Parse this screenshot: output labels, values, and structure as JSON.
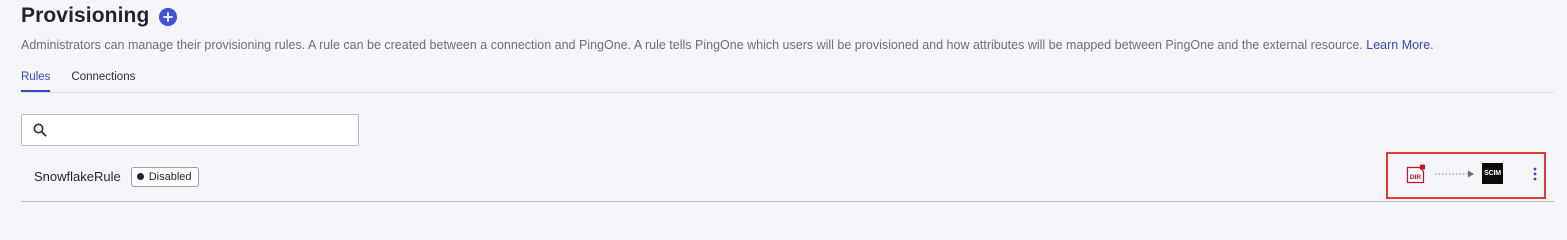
{
  "header": {
    "title": "Provisioning",
    "add_icon": "plus-circle-icon",
    "description": "Administrators can manage their provisioning rules. A rule can be created between a connection and PingOne. A rule tells PingOne which users will be provisioned and how attributes will be mapped between PingOne and the external resource.",
    "learn_more_label": "Learn More."
  },
  "tabs": [
    {
      "label": "Rules",
      "active": true
    },
    {
      "label": "Connections",
      "active": false
    }
  ],
  "search": {
    "value": "",
    "placeholder": "",
    "icon": "search-icon"
  },
  "rules": [
    {
      "name": "SnowflakeRule",
      "status": "Disabled",
      "source_icon": "directory-icon",
      "source_label": "DIR",
      "target_icon": "scim-icon",
      "target_label": "SCIM",
      "menu_icon": "more-vertical-icon"
    }
  ],
  "colors": {
    "accent": "#3546c7",
    "add_button": "#3f51d8",
    "highlight": "#e8392e",
    "dir_icon": "#c8102e",
    "background": "#f5f6fa"
  }
}
